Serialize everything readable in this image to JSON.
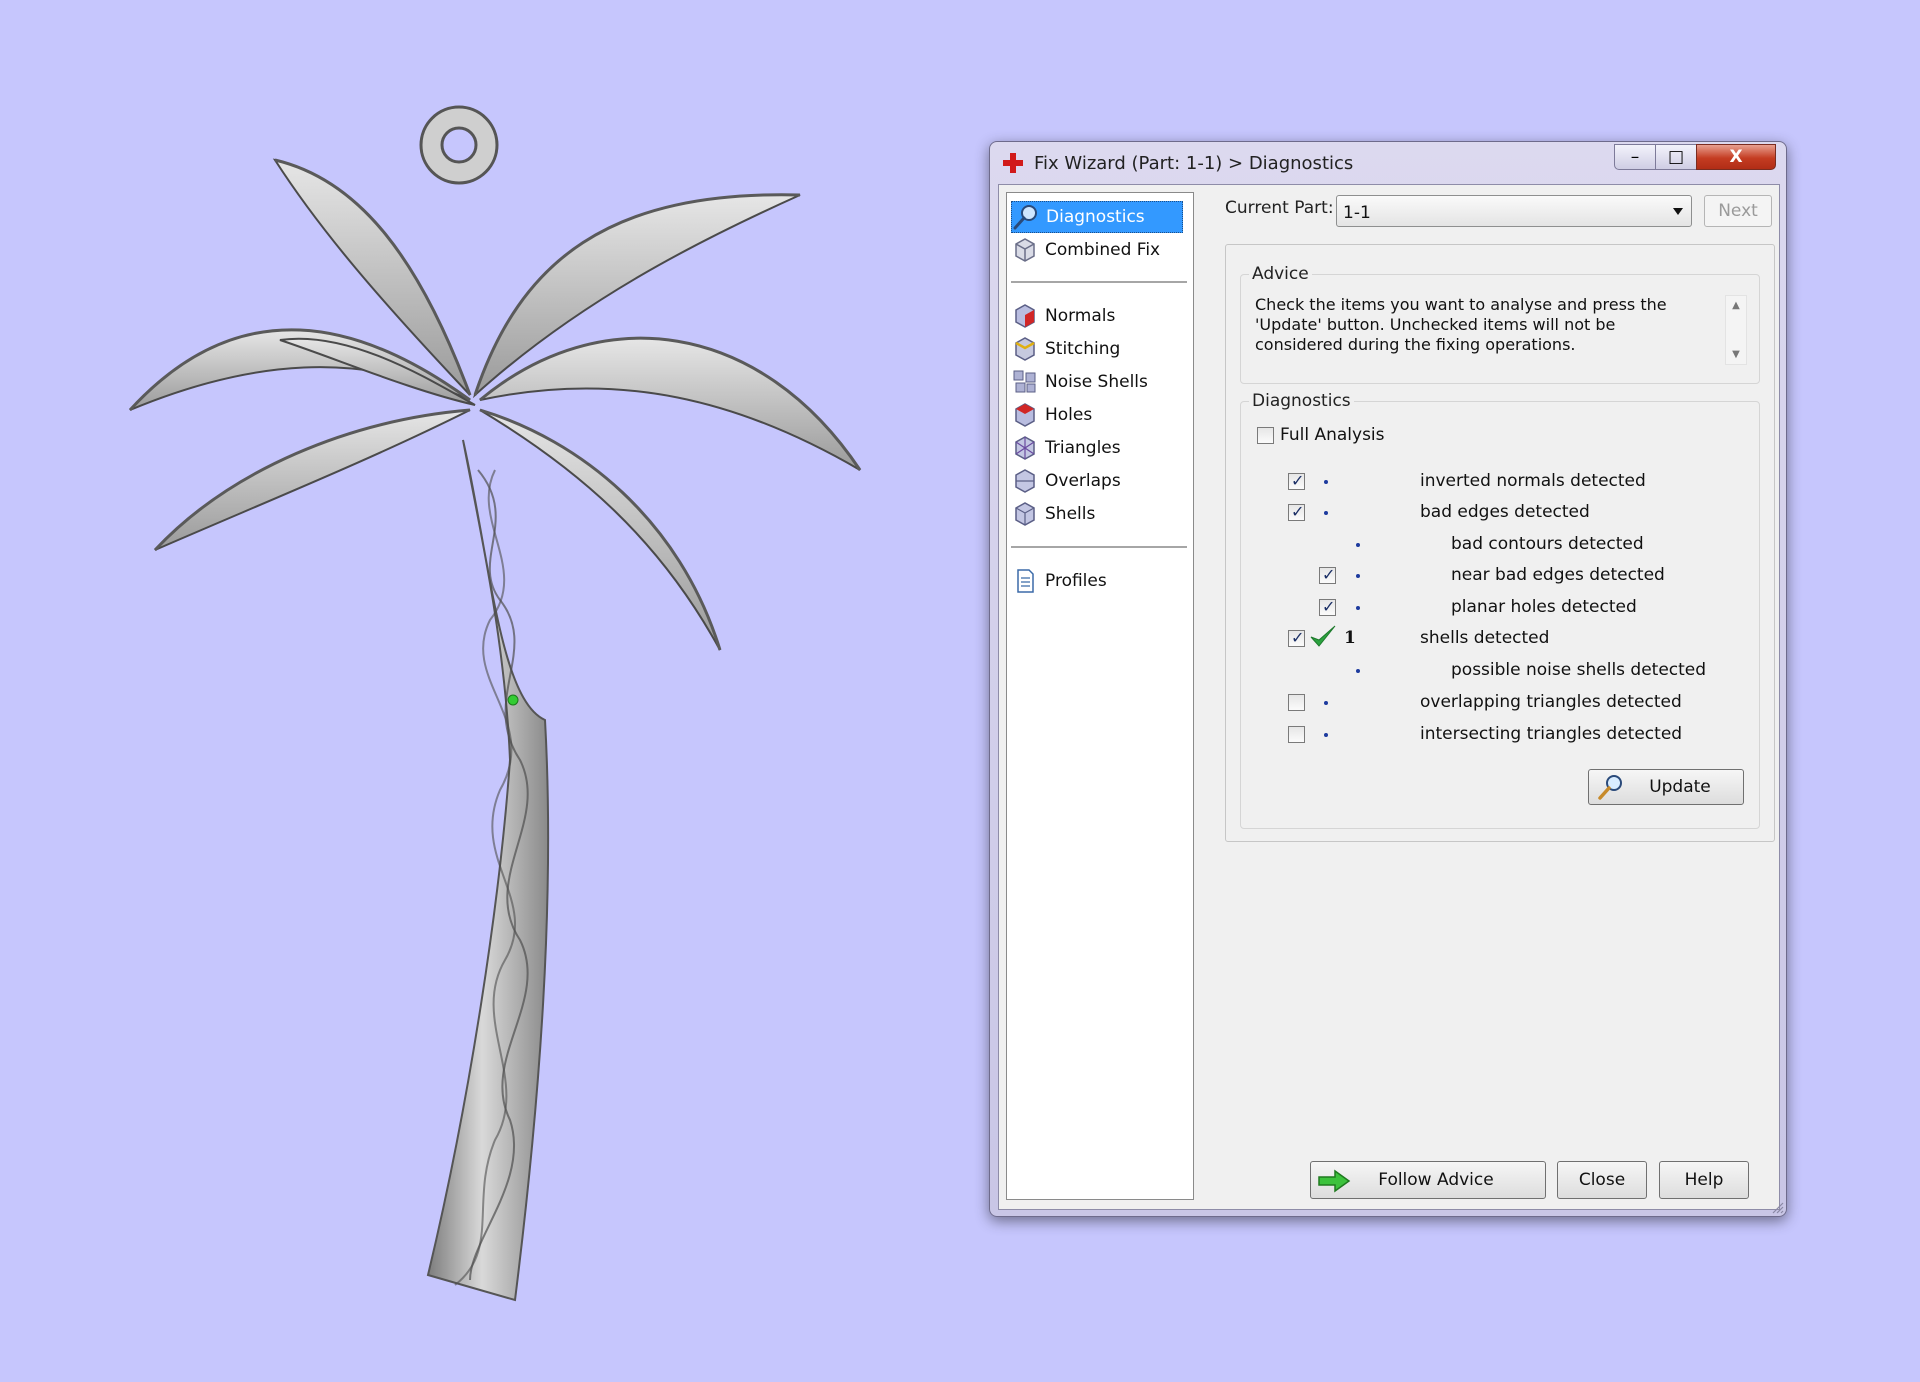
{
  "window": {
    "title": "Fix Wizard (Part: 1-1) > Diagnostics",
    "controls": {
      "close_glyph": "X"
    }
  },
  "sidebar": {
    "items": [
      {
        "label": "Diagnostics",
        "icon": "magnifier-icon",
        "selected": true
      },
      {
        "label": "Combined Fix",
        "icon": "cube-icon"
      },
      {
        "label": "Normals",
        "icon": "normals-cube-icon"
      },
      {
        "label": "Stitching",
        "icon": "stitching-cube-icon"
      },
      {
        "label": "Noise Shells",
        "icon": "noise-shells-icon"
      },
      {
        "label": "Holes",
        "icon": "holes-cube-icon"
      },
      {
        "label": "Triangles",
        "icon": "triangles-cube-icon"
      },
      {
        "label": "Overlaps",
        "icon": "overlaps-cube-icon"
      },
      {
        "label": "Shells",
        "icon": "shells-cube-icon"
      },
      {
        "label": "Profiles",
        "icon": "profiles-document-icon"
      }
    ]
  },
  "header": {
    "current_part_label": "Current Part:",
    "current_part_value": "1-1",
    "next_label": "Next"
  },
  "advice": {
    "title": "Advice",
    "text": "Check the items you want to analyse and press the 'Update' button. Unchecked items will not be considered during the fixing operations."
  },
  "diagnostics": {
    "title": "Diagnostics",
    "full_analysis_label": "Full Analysis",
    "full_analysis_checked": false,
    "rows": [
      {
        "label": "inverted normals detected",
        "checked": true
      },
      {
        "label": "bad edges detected",
        "checked": true
      },
      {
        "label": "bad contours detected"
      },
      {
        "label": "near bad edges detected",
        "checked": true
      },
      {
        "label": "planar holes detected",
        "checked": true
      },
      {
        "label": "shells detected",
        "checked": true,
        "count": "1",
        "status": "ok"
      },
      {
        "label": "possible noise shells detected"
      },
      {
        "label": "overlapping triangles detected",
        "checked": false
      },
      {
        "label": "intersecting triangles detected",
        "checked": false
      }
    ],
    "update_label": "Update"
  },
  "footer": {
    "follow_advice_label": "Follow Advice",
    "close_label": "Close",
    "help_label": "Help"
  },
  "colors": {
    "background": "#c6c6fd",
    "selection": "#3399ff",
    "ok_check": "#2ba23f",
    "close_button": "#c43c22"
  }
}
